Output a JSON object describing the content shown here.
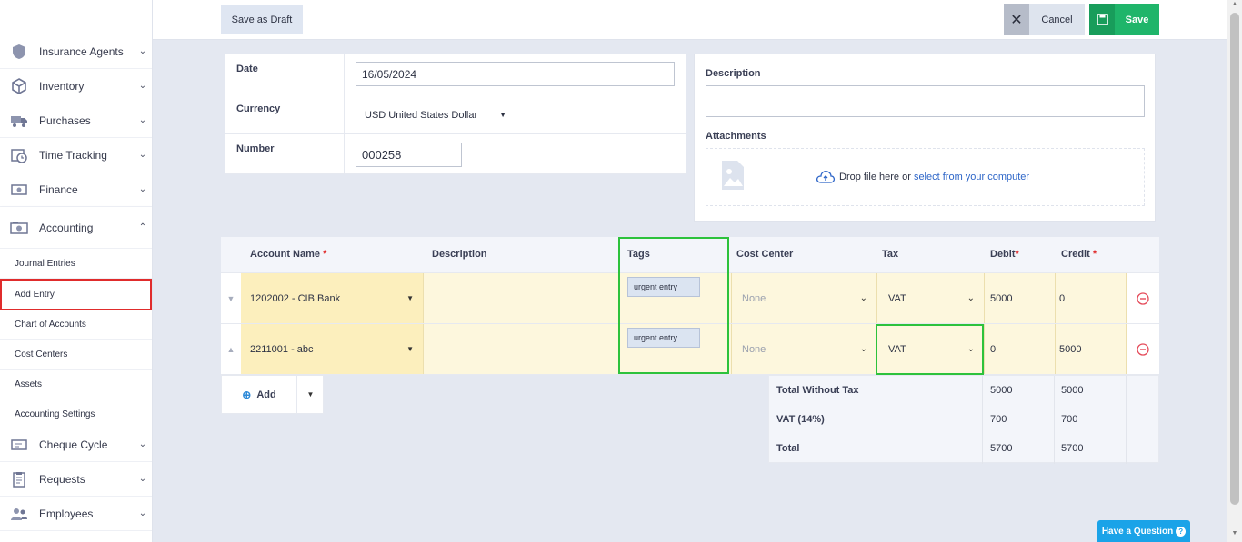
{
  "sidebar": {
    "items": [
      {
        "label": "Insurance Agents",
        "icon": "shield-icon"
      },
      {
        "label": "Inventory",
        "icon": "box-icon"
      },
      {
        "label": "Purchases",
        "icon": "truck-icon"
      },
      {
        "label": "Time Tracking",
        "icon": "clock-calendar-icon"
      },
      {
        "label": "Finance",
        "icon": "money-icon"
      },
      {
        "label": "Accounting",
        "icon": "cash-register-icon"
      }
    ],
    "accounting_sub": [
      {
        "label": "Journal Entries"
      },
      {
        "label": "Add Entry"
      },
      {
        "label": "Chart of Accounts"
      },
      {
        "label": "Cost Centers"
      },
      {
        "label": "Assets"
      },
      {
        "label": "Accounting Settings"
      }
    ],
    "items_after": [
      {
        "label": "Cheque Cycle",
        "icon": "cheque-icon"
      },
      {
        "label": "Requests",
        "icon": "clipboard-icon"
      },
      {
        "label": "Employees",
        "icon": "users-icon"
      }
    ]
  },
  "toolbar": {
    "draft_label": "Save as Draft",
    "cancel_label": "Cancel",
    "save_label": "Save"
  },
  "form": {
    "date_label": "Date",
    "date_value": "16/05/2024",
    "currency_label": "Currency",
    "currency_value": "USD United States Dollar",
    "number_label": "Number",
    "number_value": "000258",
    "description_label": "Description",
    "attachments_label": "Attachments",
    "drop_text": "Drop file here or ",
    "drop_link": "select from your computer"
  },
  "table": {
    "headers": {
      "account": "Account Name",
      "description": "Description",
      "tags": "Tags",
      "cost_center": "Cost Center",
      "tax": "Tax",
      "debit": "Debit",
      "credit": "Credit",
      "required_mark": "*"
    },
    "rows": [
      {
        "account": "1202002 - CIB Bank",
        "tag": "urgent entry",
        "cost_center": "None",
        "tax": "VAT",
        "debit": "5000",
        "credit": "0"
      },
      {
        "account": "2211001 - abc",
        "tag": "urgent entry",
        "cost_center": "None",
        "tax": "VAT",
        "debit": "0",
        "credit": "5000"
      }
    ],
    "add_label": "Add"
  },
  "totals": {
    "rows": [
      {
        "label": "Total Without Tax",
        "debit": "5000",
        "credit": "5000"
      },
      {
        "label": "VAT (14%)",
        "debit": "700",
        "credit": "700"
      },
      {
        "label": "Total",
        "debit": "5700",
        "credit": "5700"
      }
    ]
  },
  "help": {
    "label": "Have a Question",
    "q": "?"
  },
  "colors": {
    "save": "#1fb56a",
    "highlight": "#2dc23c",
    "active_border": "#e02c2c",
    "row_bg": "#fdf7dd"
  }
}
